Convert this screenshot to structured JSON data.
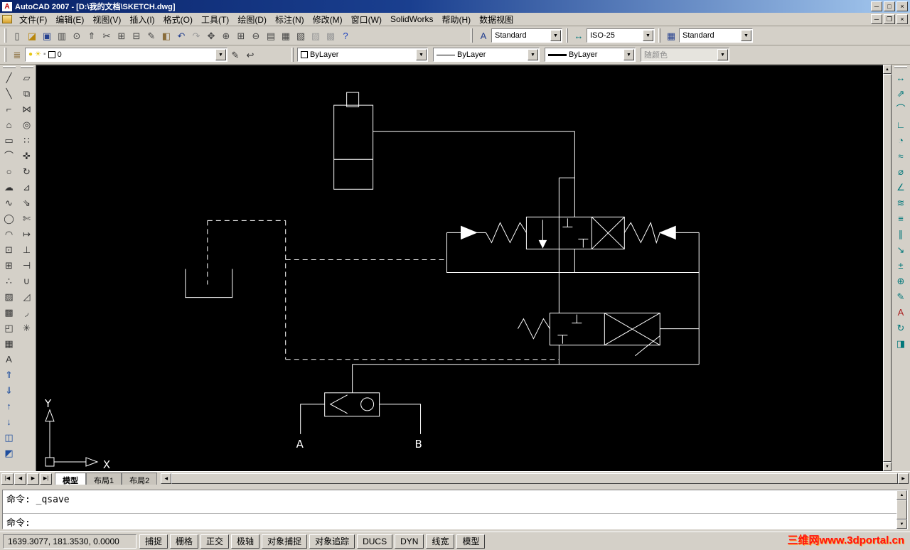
{
  "colors": {
    "titlebar_start": "#0a246a",
    "titlebar_end": "#a6caf0",
    "chrome": "#d4d0c8",
    "canvas_bg": "#000000",
    "wire": "#ffffff",
    "watermark": "#ff1010"
  },
  "ui": {
    "dropdown_arrow": "▼",
    "scroll_up": "▲",
    "scroll_down": "▼",
    "scroll_left": "◀",
    "scroll_right": "▶"
  },
  "titlebar": {
    "title": "AutoCAD 2007 - [D:\\我的文档\\SKETCH.dwg]",
    "minimize": "─",
    "maximize": "□",
    "restore": "❐",
    "close": "×"
  },
  "menubar": {
    "items": [
      {
        "name": "menu-file",
        "label": "文件(F)"
      },
      {
        "name": "menu-edit",
        "label": "编辑(E)"
      },
      {
        "name": "menu-view",
        "label": "视图(V)"
      },
      {
        "name": "menu-insert",
        "label": "插入(I)"
      },
      {
        "name": "menu-format",
        "label": "格式(O)"
      },
      {
        "name": "menu-tools",
        "label": "工具(T)"
      },
      {
        "name": "menu-draw",
        "label": "绘图(D)"
      },
      {
        "name": "menu-dimension",
        "label": "标注(N)"
      },
      {
        "name": "menu-modify",
        "label": "修改(M)"
      },
      {
        "name": "menu-window",
        "label": "窗口(W)"
      },
      {
        "name": "menu-solidworks",
        "label": "SolidWorks"
      },
      {
        "name": "menu-help",
        "label": "帮助(H)"
      },
      {
        "name": "menu-dataview",
        "label": "数据视图"
      }
    ]
  },
  "standard_toolbar": {
    "icons": [
      {
        "name": "new-icon",
        "glyph": "▯",
        "color": "#444444"
      },
      {
        "name": "open-icon",
        "glyph": "◪",
        "color": "#b8860b"
      },
      {
        "name": "save-icon",
        "glyph": "▣",
        "color": "#26418f"
      },
      {
        "name": "plot-icon",
        "glyph": "▥",
        "color": "#444444"
      },
      {
        "name": "plot-preview-icon",
        "glyph": "⊙",
        "color": "#444444"
      },
      {
        "name": "publish-icon",
        "glyph": "⇑",
        "color": "#444444"
      },
      {
        "name": "cut-icon",
        "glyph": "✂",
        "color": "#444444"
      },
      {
        "name": "copy-icon",
        "glyph": "⊞",
        "color": "#444444"
      },
      {
        "name": "paste-icon",
        "glyph": "⊟",
        "color": "#444444"
      },
      {
        "name": "match-properties-icon",
        "glyph": "✎",
        "color": "#444444"
      },
      {
        "name": "block-editor-icon",
        "glyph": "◧",
        "color": "#8a6d3b"
      },
      {
        "name": "undo-icon",
        "glyph": "↶",
        "color": "#26418f"
      },
      {
        "name": "redo-icon",
        "glyph": "↷",
        "color": "#9a9a9a"
      },
      {
        "name": "pan-icon",
        "glyph": "✥",
        "color": "#444444"
      },
      {
        "name": "zoom-realtime-icon",
        "glyph": "⊕",
        "color": "#444444"
      },
      {
        "name": "zoom-window-icon",
        "glyph": "⊞",
        "color": "#444444"
      },
      {
        "name": "zoom-previous-icon",
        "glyph": "⊖",
        "color": "#444444"
      },
      {
        "name": "properties-icon",
        "glyph": "▤",
        "color": "#444444"
      },
      {
        "name": "designcenter-icon",
        "glyph": "▦",
        "color": "#444444"
      },
      {
        "name": "tool-palettes-icon",
        "glyph": "▧",
        "color": "#444444"
      },
      {
        "name": "sheet-set-manager-icon",
        "glyph": "▨",
        "color": "#9a9a9a"
      },
      {
        "name": "markup-set-manager-icon",
        "glyph": "▩",
        "color": "#9a9a9a"
      },
      {
        "name": "help-icon",
        "glyph": "?",
        "color": "#1a3fbf"
      }
    ]
  },
  "styles_toolbar": {
    "text_style_icon": "A",
    "text_style_value": "Standard",
    "dim_style_icon": "↔",
    "dim_style_value": "ISO-25",
    "table_style_icon": "▦",
    "table_style_value": "Standard"
  },
  "layers_toolbar": {
    "layer_manager_icon": "≣",
    "bulb_icon": "●",
    "sun_icon": "☀",
    "lock_icon": "▪",
    "layer_value": "0",
    "make_current_icon": "✎",
    "layer_previous_icon": "↩"
  },
  "properties_toolbar": {
    "color_value": "ByLayer",
    "linetype_value": "ByLayer",
    "lineweight_value": "ByLayer",
    "plotstyle_value": "随颜色"
  },
  "draw_toolbar": {
    "icons": [
      {
        "name": "line-icon",
        "glyph": "╱"
      },
      {
        "name": "construction-line-icon",
        "glyph": "╲"
      },
      {
        "name": "polyline-icon",
        "glyph": "⌐"
      },
      {
        "name": "polygon-icon",
        "glyph": "⌂"
      },
      {
        "name": "rectangle-icon",
        "glyph": "▭"
      },
      {
        "name": "arc-icon",
        "glyph": "⌒"
      },
      {
        "name": "circle-icon",
        "glyph": "○"
      },
      {
        "name": "revcloud-icon",
        "glyph": "☁"
      },
      {
        "name": "spline-icon",
        "glyph": "∿"
      },
      {
        "name": "ellipse-icon",
        "glyph": "◯"
      },
      {
        "name": "ellipse-arc-icon",
        "glyph": "◠"
      },
      {
        "name": "insert-block-icon",
        "glyph": "⊡"
      },
      {
        "name": "make-block-icon",
        "glyph": "⊞"
      },
      {
        "name": "point-icon",
        "glyph": "∴"
      },
      {
        "name": "hatch-icon",
        "glyph": "▨"
      },
      {
        "name": "gradient-icon",
        "glyph": "▩"
      },
      {
        "name": "region-icon",
        "glyph": "◰"
      },
      {
        "name": "table-icon",
        "glyph": "▦"
      },
      {
        "name": "mtext-icon",
        "glyph": "A"
      }
    ]
  },
  "modify_toolbar": {
    "icons": [
      {
        "name": "erase-icon",
        "glyph": "▱"
      },
      {
        "name": "copy-object-icon",
        "glyph": "⧉"
      },
      {
        "name": "mirror-icon",
        "glyph": "⋈"
      },
      {
        "name": "offset-icon",
        "glyph": "◎"
      },
      {
        "name": "array-icon",
        "glyph": "∷"
      },
      {
        "name": "move-icon",
        "glyph": "✜"
      },
      {
        "name": "rotate-icon",
        "glyph": "↻"
      },
      {
        "name": "scale-icon",
        "glyph": "⊿"
      },
      {
        "name": "stretch-icon",
        "glyph": "⇘"
      },
      {
        "name": "trim-icon",
        "glyph": "✄"
      },
      {
        "name": "extend-icon",
        "glyph": "↦"
      },
      {
        "name": "break-at-point-icon",
        "glyph": "⊥"
      },
      {
        "name": "break-icon",
        "glyph": "⊣"
      },
      {
        "name": "join-icon",
        "glyph": "∪"
      },
      {
        "name": "chamfer-icon",
        "glyph": "◿"
      },
      {
        "name": "fillet-icon",
        "glyph": "◞"
      },
      {
        "name": "explode-icon",
        "glyph": "✳"
      }
    ]
  },
  "extra_toolbar": {
    "icons": [
      {
        "name": "draw-order-front-icon",
        "glyph": "⇑",
        "color": "#1f4e9e"
      },
      {
        "name": "draw-order-back-icon",
        "glyph": "⇓",
        "color": "#1f4e9e"
      },
      {
        "name": "draw-order-above-icon",
        "glyph": "↑",
        "color": "#1f4e9e"
      },
      {
        "name": "draw-order-under-icon",
        "glyph": "↓",
        "color": "#1f4e9e"
      },
      {
        "name": "cad-standards-icon",
        "glyph": "◫",
        "color": "#1f4e9e"
      },
      {
        "name": "layer-translate-icon",
        "glyph": "◩",
        "color": "#1f4e9e"
      }
    ]
  },
  "dim_toolbar": {
    "icons": [
      {
        "name": "linear-dimension-icon",
        "glyph": "↔",
        "color": "#00777a"
      },
      {
        "name": "aligned-dimension-icon",
        "glyph": "⇗",
        "color": "#00777a"
      },
      {
        "name": "arc-length-dimension-icon",
        "glyph": "⌒",
        "color": "#00777a"
      },
      {
        "name": "ordinate-dimension-icon",
        "glyph": "∟",
        "color": "#00777a"
      },
      {
        "name": "radius-dimension-icon",
        "glyph": "◔",
        "color": "#00777a"
      },
      {
        "name": "jogged-dimension-icon",
        "glyph": "≈",
        "color": "#00777a"
      },
      {
        "name": "diameter-dimension-icon",
        "glyph": "⌀",
        "color": "#00777a"
      },
      {
        "name": "angular-dimension-icon",
        "glyph": "∠",
        "color": "#00777a"
      },
      {
        "name": "quick-dimension-icon",
        "glyph": "≋",
        "color": "#00777a"
      },
      {
        "name": "baseline-dimension-icon",
        "glyph": "≡",
        "color": "#00777a"
      },
      {
        "name": "continue-dimension-icon",
        "glyph": "∥",
        "color": "#00777a"
      },
      {
        "name": "quick-leader-icon",
        "glyph": "↘",
        "color": "#00777a"
      },
      {
        "name": "tolerance-icon",
        "glyph": "±",
        "color": "#00777a"
      },
      {
        "name": "center-mark-icon",
        "glyph": "⊕",
        "color": "#00777a"
      },
      {
        "name": "dimension-edit-icon",
        "glyph": "✎",
        "color": "#00777a"
      },
      {
        "name": "dimension-text-edit-icon",
        "glyph": "A",
        "color": "#aa2222"
      },
      {
        "name": "dimension-update-icon",
        "glyph": "↻",
        "color": "#00777a"
      },
      {
        "name": "dimension-style-icon",
        "glyph": "◨",
        "color": "#00777a"
      }
    ]
  },
  "drawing": {
    "labels": {
      "port_a": "A",
      "port_b": "B",
      "ucs_x": "X",
      "ucs_y": "Y"
    }
  },
  "tabbar": {
    "nav": [
      {
        "name": "tab-first-button",
        "label": "|◀"
      },
      {
        "name": "tab-prev-button",
        "label": "◀"
      },
      {
        "name": "tab-next-button",
        "label": "▶"
      },
      {
        "name": "tab-last-button",
        "label": "▶|"
      }
    ],
    "tabs": [
      {
        "name": "tab-model",
        "label": "模型"
      },
      {
        "name": "tab-layout1",
        "label": "布局1"
      },
      {
        "name": "tab-layout2",
        "label": "布局2"
      }
    ]
  },
  "command": {
    "history_line": "命令: _qsave",
    "prompt_line": "命令:"
  },
  "statusbar": {
    "coords": "1639.3077, 181.3530, 0.0000",
    "toggles": [
      {
        "name": "snap-toggle",
        "label": "捕捉"
      },
      {
        "name": "grid-toggle",
        "label": "栅格"
      },
      {
        "name": "ortho-toggle",
        "label": "正交"
      },
      {
        "name": "polar-toggle",
        "label": "极轴"
      },
      {
        "name": "osnap-toggle",
        "label": "对象捕捉"
      },
      {
        "name": "otrack-toggle",
        "label": "对象追踪"
      },
      {
        "name": "ducs-toggle",
        "label": "DUCS"
      },
      {
        "name": "dyn-toggle",
        "label": "DYN"
      },
      {
        "name": "lwt-toggle",
        "label": "线宽"
      },
      {
        "name": "model-toggle",
        "label": "模型"
      }
    ]
  },
  "watermark": {
    "text": "三维网www.3dportal.cn"
  }
}
